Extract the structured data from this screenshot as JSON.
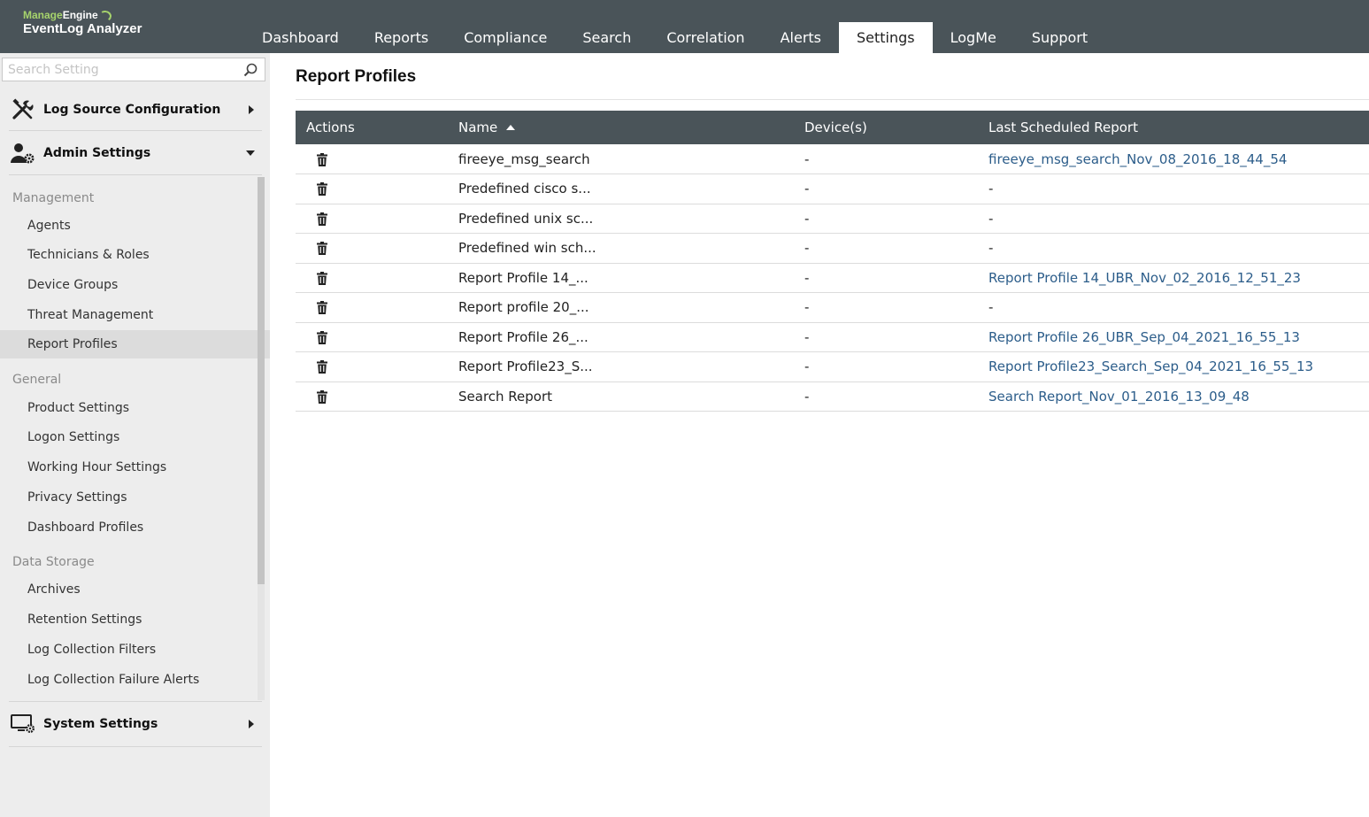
{
  "app": {
    "brand_left": "Manage",
    "brand_right": "Engine",
    "product": "EventLog Analyzer"
  },
  "nav": {
    "tabs": [
      "Dashboard",
      "Reports",
      "Compliance",
      "Search",
      "Correlation",
      "Alerts",
      "Settings",
      "LogMe",
      "Support"
    ],
    "active": "Settings"
  },
  "sidebar": {
    "search_placeholder": "Search Setting",
    "sections": {
      "log_source": "Log Source Configuration",
      "admin": "Admin Settings",
      "system": "System Settings"
    },
    "groups": {
      "management": {
        "label": "Management",
        "items": [
          "Agents",
          "Technicians & Roles",
          "Device Groups",
          "Threat Management",
          "Report Profiles"
        ]
      },
      "general": {
        "label": "General",
        "items": [
          "Product Settings",
          "Logon Settings",
          "Working Hour Settings",
          "Privacy Settings",
          "Dashboard Profiles"
        ]
      },
      "data_storage": {
        "label": "Data Storage",
        "items": [
          "Archives",
          "Retention Settings",
          "Log Collection Filters",
          "Log Collection Failure Alerts"
        ]
      }
    },
    "active_item": "Report Profiles"
  },
  "main": {
    "title": "Report Profiles",
    "columns": [
      "Actions",
      "Name",
      "Device(s)",
      "Last Scheduled Report"
    ],
    "sort_column": "Name",
    "sort_direction": "ascending",
    "rows": [
      {
        "name": "fireeye_msg_search",
        "devices": "-",
        "last": "fireeye_msg_search_Nov_08_2016_18_44_54"
      },
      {
        "name": "Predefined cisco s...",
        "devices": "-",
        "last": "-"
      },
      {
        "name": "Predefined unix sc...",
        "devices": "-",
        "last": "-"
      },
      {
        "name": "Predefined win sch...",
        "devices": "-",
        "last": "-"
      },
      {
        "name": "Report Profile 14_...",
        "devices": "-",
        "last": "Report Profile 14_UBR_Nov_02_2016_12_51_23"
      },
      {
        "name": "Report profile 20_...",
        "devices": "-",
        "last": "-"
      },
      {
        "name": "Report Profile 26_...",
        "devices": "-",
        "last": "Report Profile 26_UBR_Sep_04_2021_16_55_13"
      },
      {
        "name": "Report Profile23_S...",
        "devices": "-",
        "last": "Report Profile23_Search_Sep_04_2021_16_55_13"
      },
      {
        "name": "Search Report",
        "devices": "-",
        "last": "Search Report_Nov_01_2016_13_09_48"
      }
    ]
  },
  "colors": {
    "header_bg": "#4a5459",
    "sidebar_bg": "#ededed",
    "link": "#2c5d8a",
    "brand_green": "#a6d36c"
  }
}
